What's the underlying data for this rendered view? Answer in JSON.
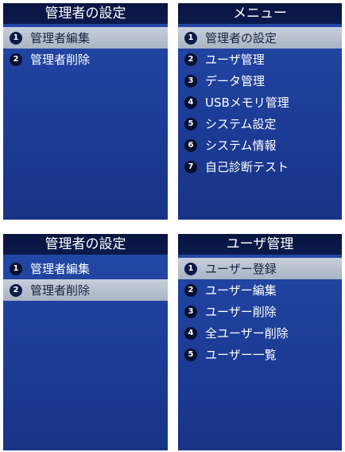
{
  "screens": [
    {
      "title": "管理者の設定",
      "selected_index": 0,
      "items": [
        {
          "num": "1",
          "label": "管理者編集"
        },
        {
          "num": "2",
          "label": "管理者削除"
        }
      ]
    },
    {
      "title": "メニュー",
      "selected_index": 0,
      "items": [
        {
          "num": "1",
          "label": "管理者の設定"
        },
        {
          "num": "2",
          "label": "ユーザ管理"
        },
        {
          "num": "3",
          "label": "データ管理"
        },
        {
          "num": "4",
          "label": "USBメモリ管理"
        },
        {
          "num": "5",
          "label": "システム設定"
        },
        {
          "num": "6",
          "label": "システム情報"
        },
        {
          "num": "7",
          "label": "自己診断テスト"
        }
      ]
    },
    {
      "title": "管理者の設定",
      "selected_index": 1,
      "items": [
        {
          "num": "1",
          "label": "管理者編集"
        },
        {
          "num": "2",
          "label": "管理者削除"
        }
      ]
    },
    {
      "title": "ユーザ管理",
      "selected_index": 0,
      "items": [
        {
          "num": "1",
          "label": "ユーザー登録"
        },
        {
          "num": "2",
          "label": "ユーザー編集"
        },
        {
          "num": "3",
          "label": "ユーザー削除"
        },
        {
          "num": "4",
          "label": "全ユーザー削除"
        },
        {
          "num": "5",
          "label": "ユーザー一覧"
        }
      ]
    }
  ]
}
